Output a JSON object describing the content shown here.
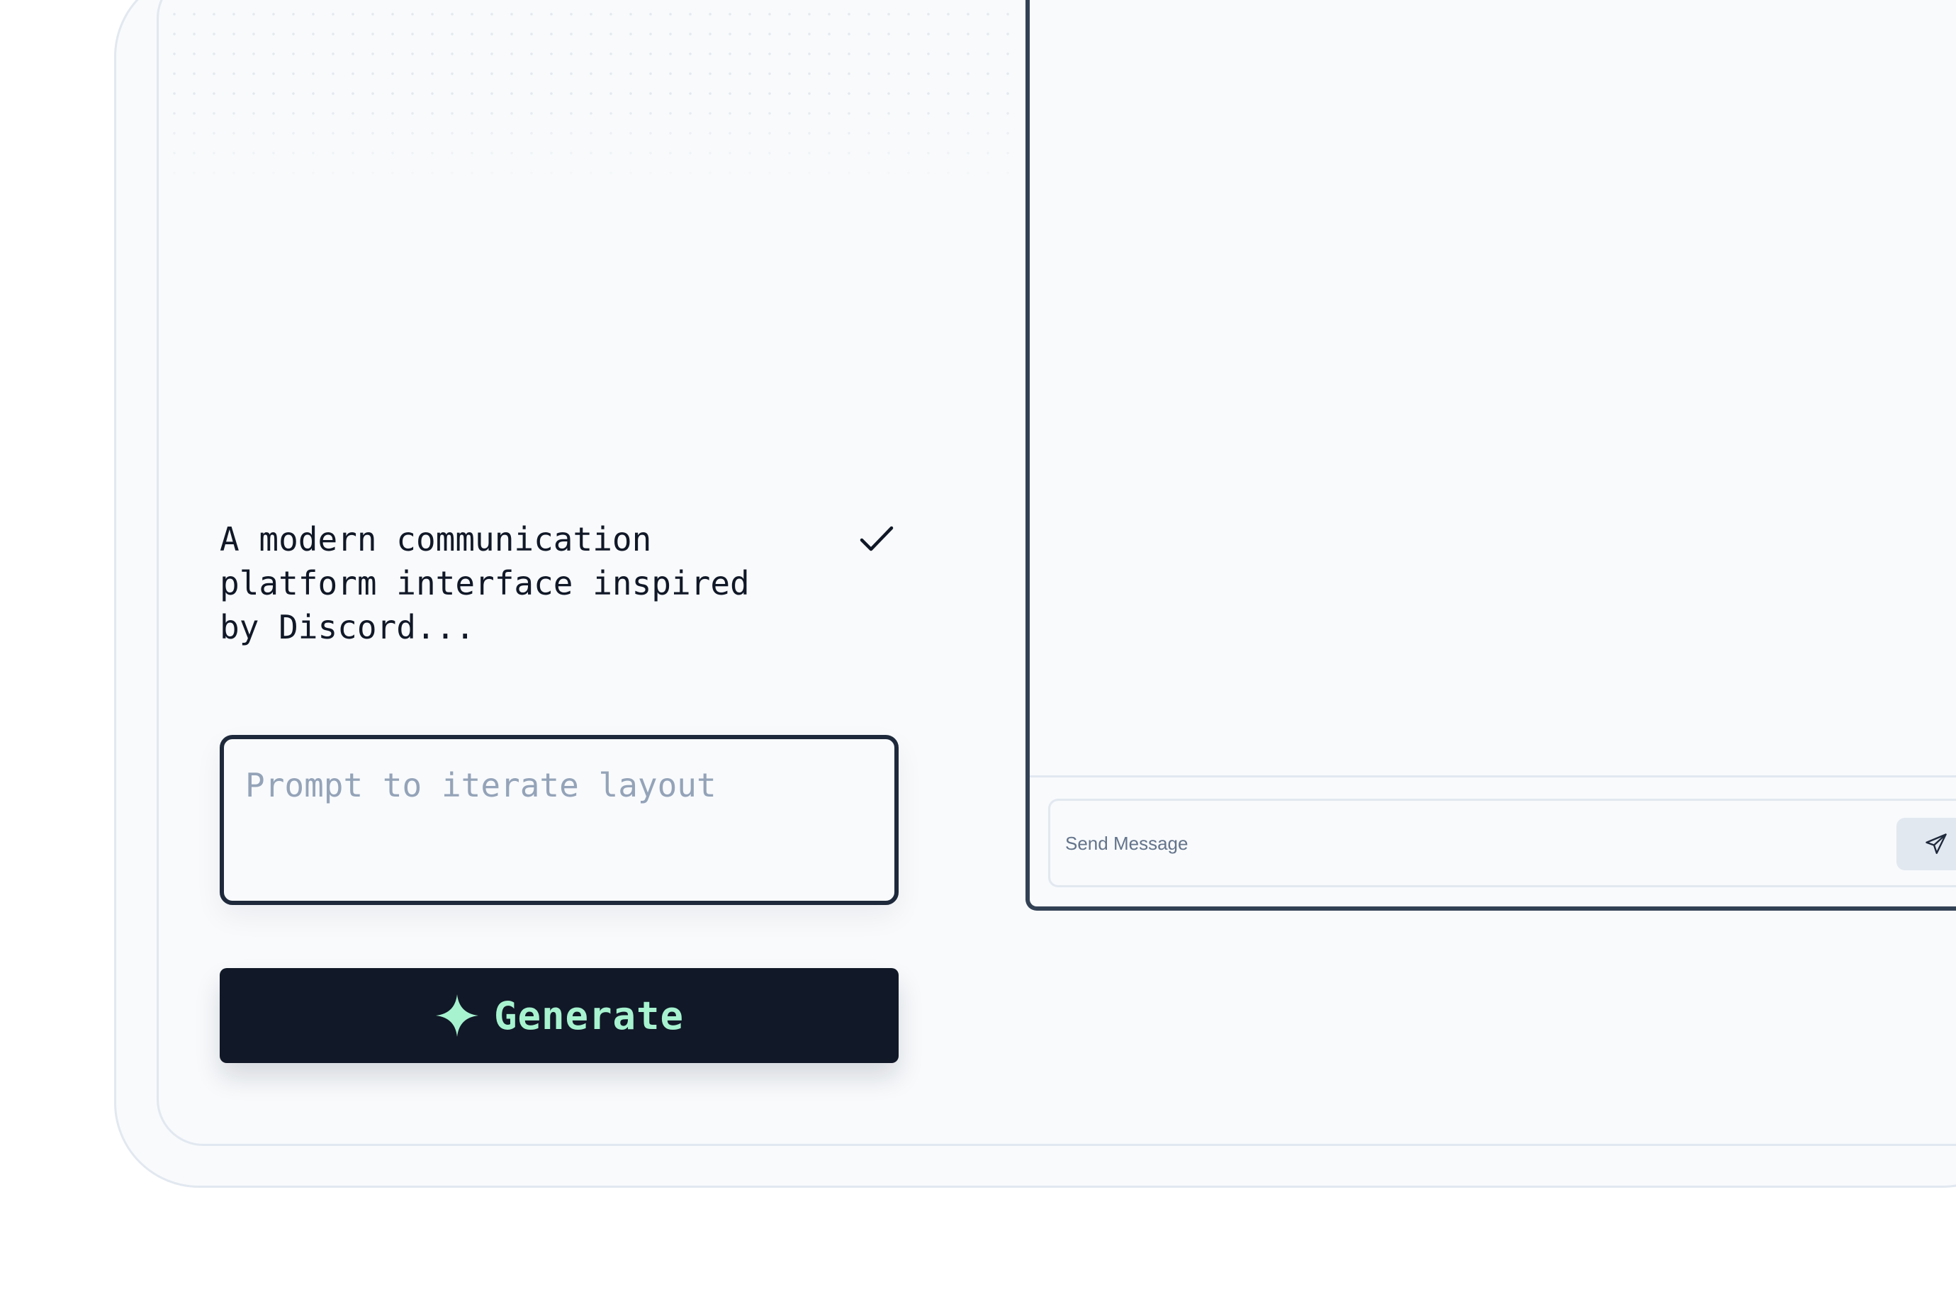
{
  "editor": {
    "description": "A modern communication\nplatform interface inspired\nby Discord...",
    "prompt_placeholder": "Prompt to iterate layout",
    "generate_label": "Generate"
  },
  "preview": {
    "message_placeholder": "Send Message"
  },
  "icons": {
    "confirm": "check-icon",
    "generate": "sparkle-icon",
    "send": "send-icon"
  },
  "colors": {
    "canvas": "#f8fafc",
    "panel_border": "#334155",
    "button_bg": "#111827",
    "accent": "#a7f3d0"
  }
}
